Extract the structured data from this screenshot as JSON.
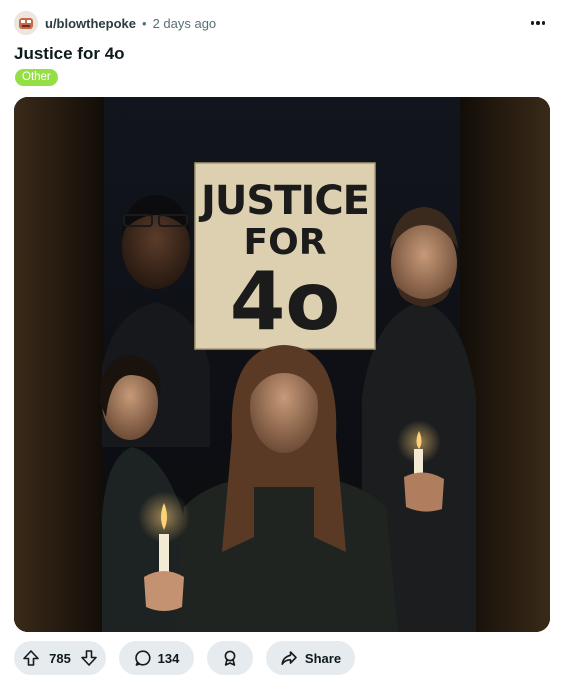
{
  "post": {
    "username": "u/blowthepoke",
    "separator": "•",
    "age": "2 days ago",
    "title": "Justice for 4o",
    "flair": "Other"
  },
  "image": {
    "sign_line1": "JUSTICE",
    "sign_line2": "FOR",
    "sign_line3": "4o"
  },
  "actions": {
    "upvotes": "785",
    "comments": "134",
    "share_label": "Share"
  },
  "icons": [
    "avatar",
    "more-icon",
    "upvote-icon",
    "downvote-icon",
    "comment-icon",
    "award-icon",
    "share-icon"
  ],
  "colors": {
    "flair_bg": "#94e044",
    "pill_bg": "#e5ebee",
    "candle_flame": "#ffd27a"
  }
}
